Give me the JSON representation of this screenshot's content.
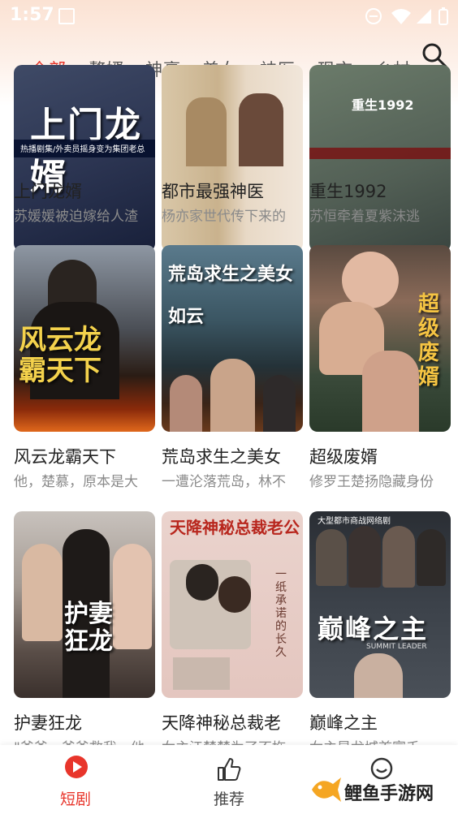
{
  "status_bar": {
    "time": "1:57"
  },
  "tabs": [
    {
      "label": "全部",
      "active": true
    },
    {
      "label": "赘婿"
    },
    {
      "label": "神豪"
    },
    {
      "label": "美女"
    },
    {
      "label": "神医"
    },
    {
      "label": "现言"
    },
    {
      "label": "乡村"
    }
  ],
  "cards": [
    {
      "title": "上门龙婿",
      "desc": "苏媛媛被迫嫁给人渣",
      "poster_text": "上门龙婿",
      "poster_caption": "热播剧集/外卖员摇身变为集团老总"
    },
    {
      "title": "都市最强神医",
      "desc": "杨亦家世代传下来的"
    },
    {
      "title": "重生1992",
      "desc": "苏恒牵着夏紫沫逃",
      "poster_caption": "重生1992"
    },
    {
      "title": "风云龙霸天下",
      "desc": "他，楚慕，原本是大",
      "poster_text": "风云龙霸天下"
    },
    {
      "title": "荒岛求生之美女",
      "desc": "一遭沦落荒岛，林不",
      "poster_text": "荒岛求生之美女如云"
    },
    {
      "title": "超级废婿",
      "desc": "修罗王楚扬隐藏身份",
      "poster_text": "超级废婿"
    },
    {
      "title": "护妻狂龙",
      "desc": "\"爸爸，爸爸救我，他",
      "poster_text": "护妻狂龙"
    },
    {
      "title": "天降神秘总裁老",
      "desc": "女主江楚楚为了不拖",
      "poster_text": "天降神秘总裁老公",
      "poster_text2": "一纸承诺的长久"
    },
    {
      "title": "巅峰之主",
      "desc": "女主是龙城首富千",
      "poster_text": "巅峰之主",
      "poster_caption": "大型都市商战网络剧",
      "poster_sub": "SUMMIT LEADER"
    }
  ],
  "bottom_nav": [
    {
      "label": "短剧",
      "active": true,
      "icon": "play-icon"
    },
    {
      "label": "推荐",
      "icon": "thumbs-up-icon"
    },
    {
      "label": "",
      "icon": "user-icon"
    }
  ],
  "watermark": {
    "text": "鲤鱼手游网"
  },
  "colors": {
    "accent": "#e8352b",
    "text": "#222222",
    "muted": "#8a8a8a"
  }
}
